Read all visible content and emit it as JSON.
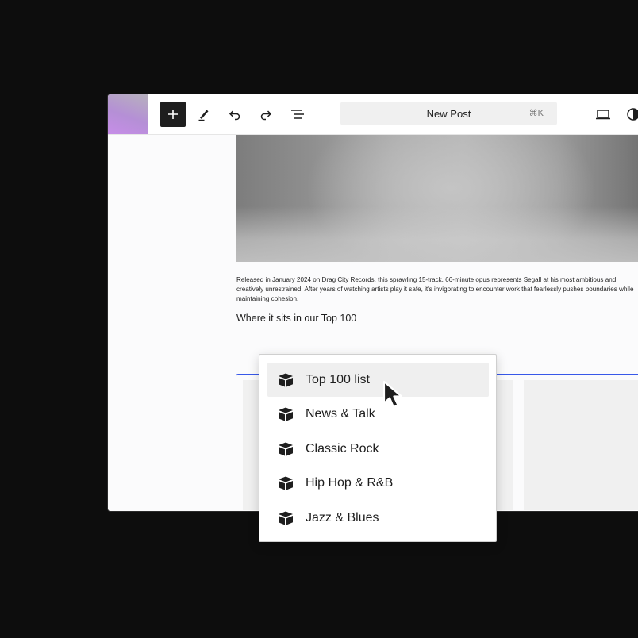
{
  "toolbar": {
    "add_block_label": "Add block",
    "search_label": "New Post",
    "search_shortcut": "⌘K",
    "icons": [
      "plus-icon",
      "pencil-icon",
      "undo-icon",
      "redo-icon",
      "list-view-icon",
      "laptop-icon",
      "contrast-icon"
    ],
    "brand_gradient": [
      "#b6b1bd",
      "#c78ee8"
    ]
  },
  "content": {
    "paragraph_lines": [
      "Released in January 2024 on Drag City Records, this sprawling 15-track,  66-minute opus represents Segall at his most ambitious and",
      "creatively  unrestrained. After years of watching artists play it safe, it's  invigorating to encounter work that fearlessly pushes boundaries while",
      "maintaining cohesion."
    ],
    "heading": "Where it sits in our Top 100"
  },
  "dropdown": {
    "items": [
      {
        "label": "Top 100 list",
        "icon": "block-icon",
        "active": true
      },
      {
        "label": "News & Talk",
        "icon": "block-icon",
        "active": false
      },
      {
        "label": "Classic Rock",
        "icon": "block-icon",
        "active": false
      },
      {
        "label": "Hip Hop & R&B",
        "icon": "block-icon",
        "active": false
      },
      {
        "label": "Jazz & Blues",
        "icon": "block-icon",
        "active": false
      }
    ]
  },
  "colors": {
    "accent": "#3858e9",
    "background": "#0d0d0d",
    "text": "#1e1e1e",
    "highlight": "#efefef"
  }
}
